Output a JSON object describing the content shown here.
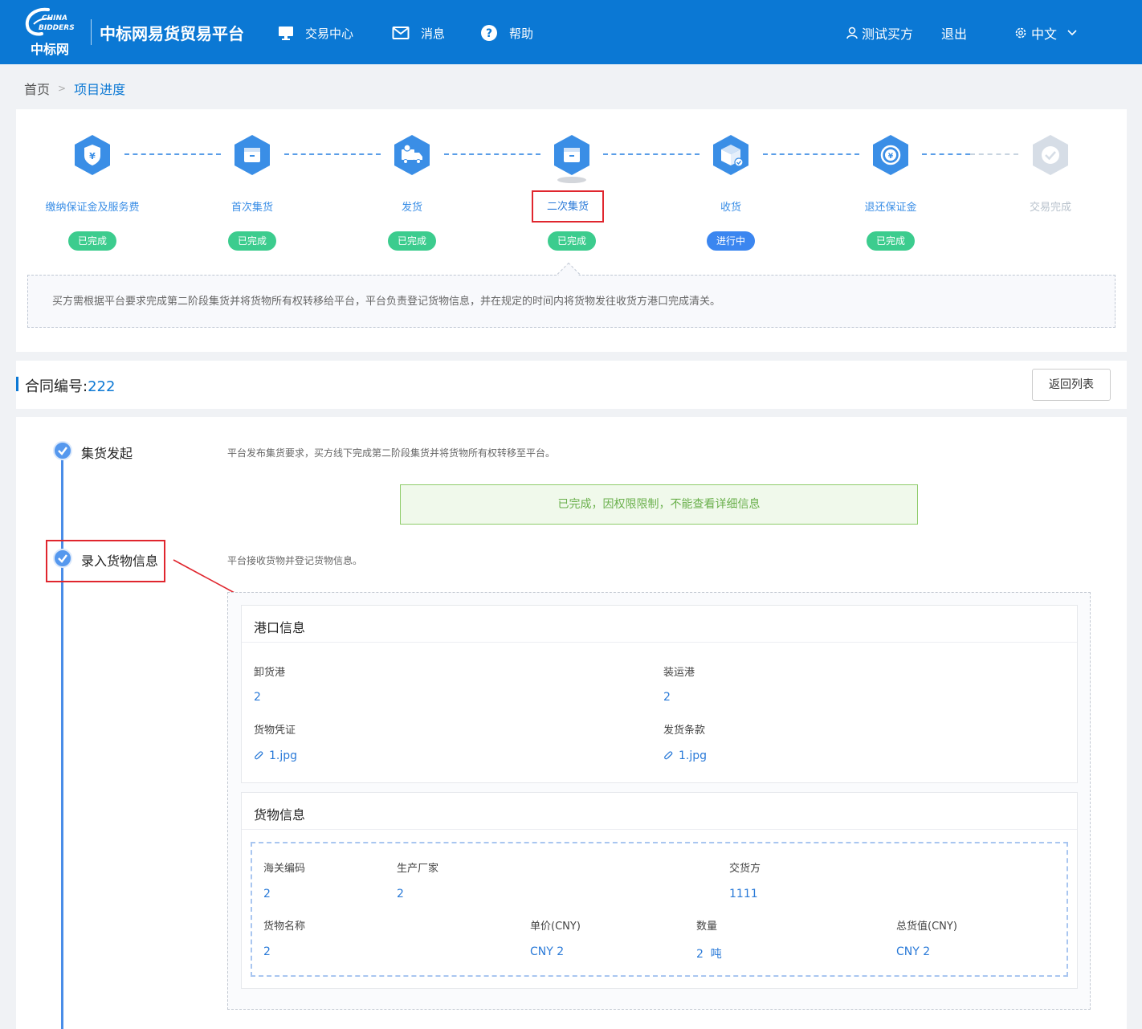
{
  "header": {
    "logo_text": "中标网",
    "logo_tagline": "CHINA BIDDERS",
    "platform_name": "中标网易货贸易平台",
    "nav": [
      {
        "label": "交易中心",
        "icon": "monitor-icon"
      },
      {
        "label": "消息",
        "icon": "mail-icon"
      },
      {
        "label": "帮助",
        "icon": "help-icon"
      }
    ],
    "user_name": "测试买方",
    "logout": "退出",
    "language": "中文"
  },
  "breadcrumb": {
    "home": "首页",
    "current": "项目进度"
  },
  "steps": [
    {
      "label": "缴纳保证金及服务费",
      "status": "已完成",
      "icon": "yuan-shield-icon"
    },
    {
      "label": "首次集货",
      "status": "已完成",
      "icon": "box-icon"
    },
    {
      "label": "发货",
      "status": "已完成",
      "icon": "truck-icon"
    },
    {
      "label": "二次集货",
      "status": "已完成",
      "icon": "box-icon"
    },
    {
      "label": "收货",
      "status": "进行中",
      "icon": "package-check-icon"
    },
    {
      "label": "退还保证金",
      "status": "已完成",
      "icon": "yuan-refresh-icon"
    },
    {
      "label": "交易完成",
      "status": "",
      "icon": "check-icon"
    }
  ],
  "step_description": "买方需根据平台要求完成第二阶段集货并将货物所有权转移给平台，平台负责登记货物信息，并在规定的时间内将货物发往收货方港口完成清关。",
  "contract": {
    "label": "合同编号:",
    "number": "222",
    "back_button": "返回列表"
  },
  "timeline": [
    {
      "title": "集货发起",
      "desc": "平台发布集货要求，买方线下完成第二阶段集货并将货物所有权转移至平台。",
      "notice": "已完成，因权限限制，不能查看详细信息"
    },
    {
      "title": "录入货物信息",
      "desc": "平台接收货物并登记货物信息。"
    }
  ],
  "port_info": {
    "title": "港口信息",
    "unload_port_label": "卸货港",
    "unload_port_value": "2",
    "load_port_label": "装运港",
    "load_port_value": "2",
    "cargo_cert_label": "货物凭证",
    "cargo_cert_file": "1.jpg",
    "ship_terms_label": "发货条款",
    "ship_terms_file": "1.jpg"
  },
  "cargo_info": {
    "title": "货物信息",
    "customs_code_label": "海关编码",
    "customs_code_value": "2",
    "manufacturer_label": "生产厂家",
    "manufacturer_value": "2",
    "delivery_party_label": "交货方",
    "delivery_party_value": "1111",
    "goods_name_label": "货物名称",
    "goods_name_value": "2",
    "unit_price_label": "单价(CNY)",
    "unit_price_value": "CNY 2",
    "quantity_label": "数量",
    "quantity_value": "2  吨",
    "total_value_label": "总货值(CNY)",
    "total_value_value": "CNY 2"
  },
  "colors": {
    "brand": "#0b78d4",
    "done": "#3ccc8e",
    "in_progress": "#3b86f0",
    "highlight": "#e0262e"
  }
}
